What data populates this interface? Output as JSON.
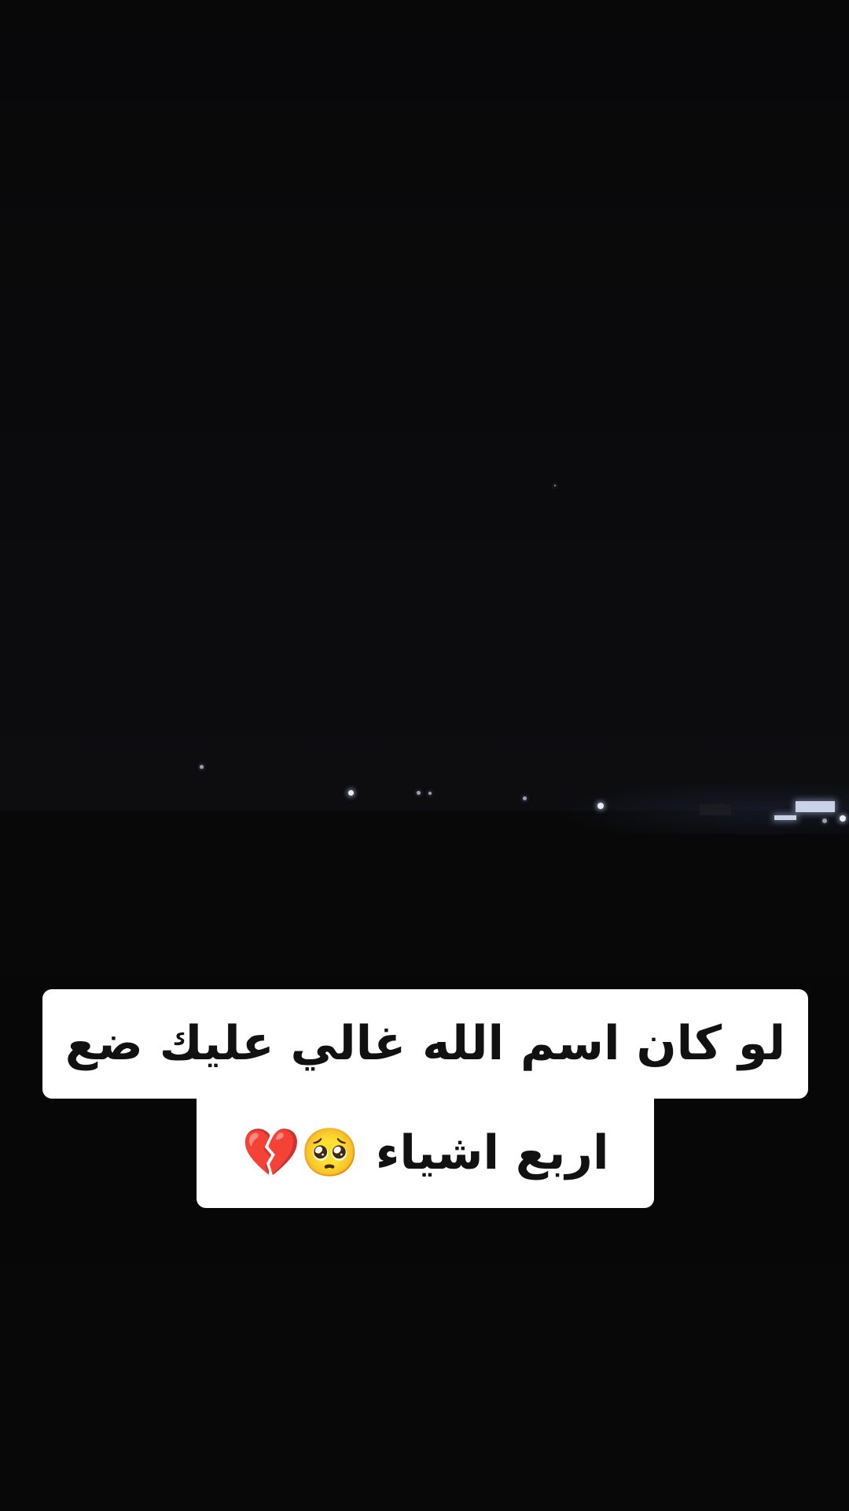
{
  "caption": {
    "line1": "لو كان اسم الله غالي عليك ضع",
    "line2": "اربع اشياء 🥺💔"
  },
  "colors": {
    "background": "#09090a",
    "caption_box": "#ffffff",
    "caption_text": "#111111"
  }
}
